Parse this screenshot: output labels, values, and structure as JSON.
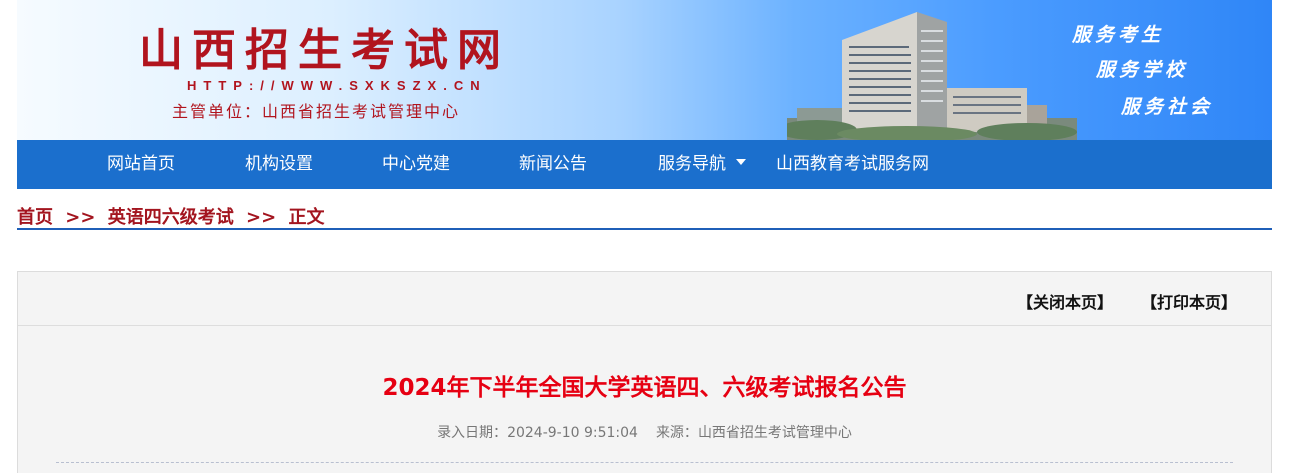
{
  "header": {
    "site_title": "山西招生考试网",
    "url": "HTTP://WWW.SXKSZX.CN",
    "org": "主管单位：山西省招生考试管理中心",
    "slogans": [
      "服务考生",
      "服务学校",
      "服务社会"
    ],
    "title_color": "#b1141e"
  },
  "nav": {
    "background": "#1b6fcd",
    "items": [
      {
        "label": "网站首页"
      },
      {
        "label": "机构设置"
      },
      {
        "label": "中心党建"
      },
      {
        "label": "新闻公告"
      },
      {
        "label": "服务导航",
        "icon": "caret-down-icon"
      },
      {
        "label": "山西教育考试服务网"
      }
    ]
  },
  "breadcrumb": {
    "home": "首页",
    "separator": ">>",
    "section": "英语四六级考试",
    "current": "正文"
  },
  "article": {
    "close_label": "【关闭本页】",
    "print_label": "【打印本页】",
    "title": "2024年下半年全国大学英语四、六级考试报名公告",
    "date_label": "录入日期：",
    "date": "2024-9-10 9:51:04",
    "source_label": "来源：",
    "source": "山西省招生考试管理中心",
    "title_color": "#e60012"
  }
}
